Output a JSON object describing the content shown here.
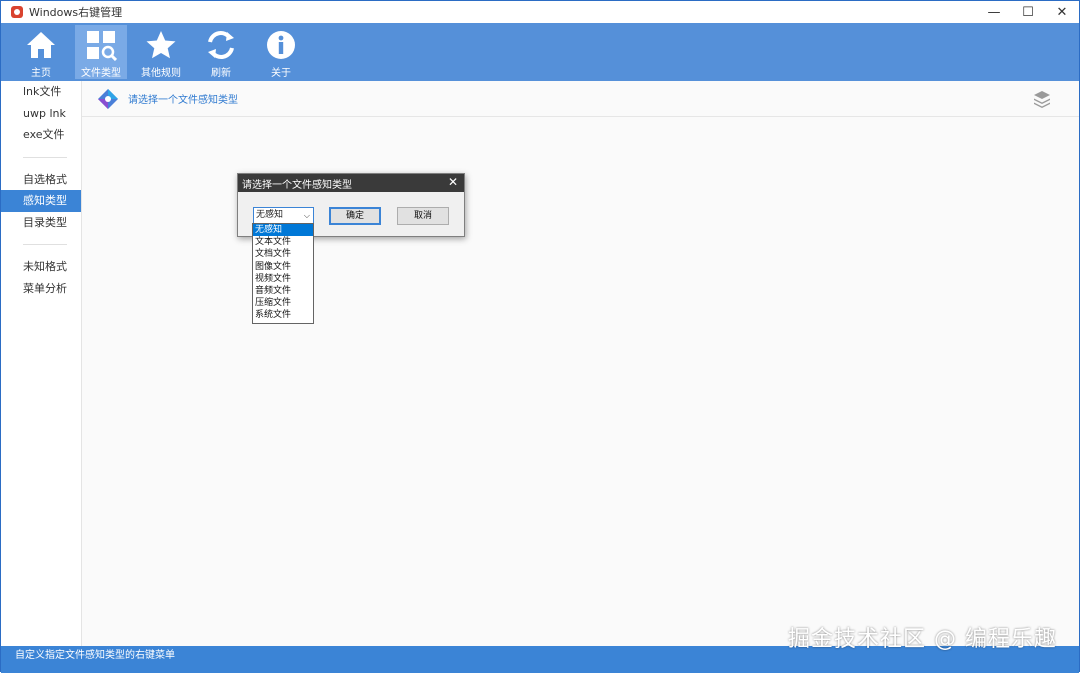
{
  "window": {
    "title": "Windows右键管理",
    "controls": {
      "minimize": "—",
      "maximize": "☐",
      "close": "✕"
    }
  },
  "toolbar": {
    "items": [
      {
        "label": "主页",
        "icon": "home-icon"
      },
      {
        "label": "文件类型",
        "icon": "file-types-icon",
        "active": true
      },
      {
        "label": "其他规则",
        "icon": "star-icon"
      },
      {
        "label": "刷新",
        "icon": "refresh-icon"
      },
      {
        "label": "关于",
        "icon": "info-icon"
      }
    ]
  },
  "sidebar": {
    "groups": [
      [
        "lnk文件",
        "uwp lnk",
        "exe文件"
      ],
      [
        "自选格式",
        "感知类型",
        "目录类型"
      ],
      [
        "未知格式",
        "菜单分析"
      ]
    ],
    "active": "感知类型"
  },
  "content": {
    "header_text": "请选择一个文件感知类型"
  },
  "dialog": {
    "title": "请选择一个文件感知类型",
    "combo_value": "无感知",
    "ok_label": "确定",
    "cancel_label": "取消",
    "options": [
      "无感知",
      "文本文件",
      "文档文件",
      "图像文件",
      "视频文件",
      "音频文件",
      "压缩文件",
      "系统文件"
    ],
    "selected_option": "无感知"
  },
  "statusbar": {
    "text": "自定义指定文件感知类型的右键菜单"
  },
  "watermark": "掘金技术社区 @ 编程乐趣",
  "colors": {
    "toolbar": "#5590d9",
    "accent": "#3b84d6",
    "selection": "#0078d7"
  }
}
